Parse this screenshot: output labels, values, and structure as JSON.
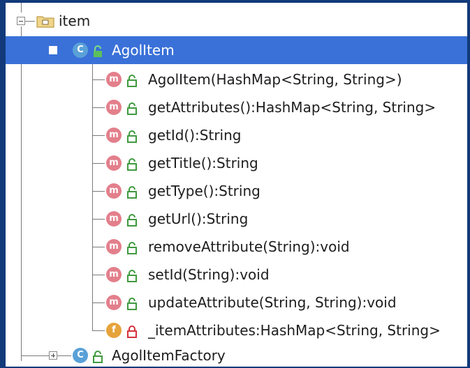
{
  "tree": {
    "package": {
      "label": "item",
      "icon": "folder-package-icon"
    },
    "selected_class": {
      "label": "AgolItem",
      "badge": "C",
      "icon": "class-icon",
      "members": [
        {
          "badge": "m",
          "access": "public",
          "label": "AgolItem(HashMap<String, String>)"
        },
        {
          "badge": "m",
          "access": "public",
          "label": "getAttributes():HashMap<String, String>"
        },
        {
          "badge": "m",
          "access": "public",
          "label": "getId():String"
        },
        {
          "badge": "m",
          "access": "public",
          "label": "getTitle():String"
        },
        {
          "badge": "m",
          "access": "public",
          "label": "getType():String"
        },
        {
          "badge": "m",
          "access": "public",
          "label": "getUrl():String"
        },
        {
          "badge": "m",
          "access": "public",
          "label": "removeAttribute(String):void"
        },
        {
          "badge": "m",
          "access": "public",
          "label": "setId(String):void"
        },
        {
          "badge": "m",
          "access": "public",
          "label": "updateAttribute(String, String):void"
        },
        {
          "badge": "f",
          "access": "private",
          "label": "_itemAttributes:HashMap<String, String>"
        }
      ]
    },
    "sibling_class": {
      "label": "AgolItemFactory",
      "badge": "C",
      "icon": "class-icon"
    }
  },
  "colors": {
    "selection": "#3a71d8",
    "frame": "#123a7a",
    "method_badge": "#e37f8b",
    "class_badge": "#5aa1d8",
    "field_badge": "#e6a33b",
    "public_lock": "#3f9a3f",
    "private_lock": "#d4323c"
  }
}
